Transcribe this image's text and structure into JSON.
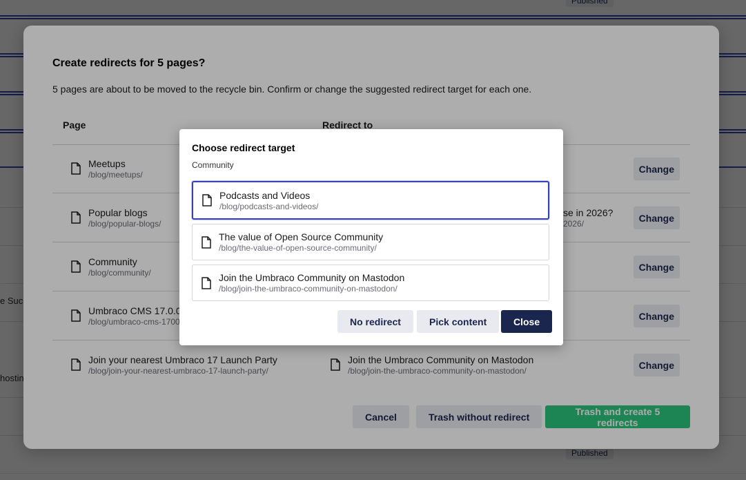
{
  "background": {
    "left_fragments": [
      "e Succ",
      "hostin"
    ],
    "pills": [
      "Published",
      "Published"
    ]
  },
  "dialog": {
    "title": "Create redirects for 5 pages?",
    "description": "5 pages are about to be moved to the recycle bin. Confirm or change the suggested redirect target for each one.",
    "columns": {
      "page": "Page",
      "redirect_to": "Redirect to"
    },
    "rows": [
      {
        "page_name": "Meetups",
        "page_url": "/blog/meetups/",
        "target_name": "",
        "target_url": "",
        "change_label": "Change"
      },
      {
        "page_name": "Popular blogs",
        "page_url": "/blog/popular-blogs/",
        "target_name": "se in 2026?",
        "target_url": "2026/",
        "change_label": "Change"
      },
      {
        "page_name": "Community",
        "page_url": "/blog/community/",
        "target_name": "",
        "target_url": "",
        "change_label": "Change"
      },
      {
        "page_name": "Umbraco CMS 17.0.0",
        "page_url": "/blog/umbraco-cms-1700",
        "target_name": "",
        "target_url": "",
        "change_label": "Change"
      },
      {
        "page_name": "Join your nearest Umbraco 17 Launch Party",
        "page_url": "/blog/join-your-nearest-umbraco-17-launch-party/",
        "target_name": "Join the Umbraco Community on Mastodon",
        "target_url": "/blog/join-the-umbraco-community-on-mastodon/",
        "change_label": "Change"
      }
    ],
    "footer": {
      "cancel": "Cancel",
      "trash_without_redirect": "Trash without redirect",
      "trash_and_create": "Trash and create 5 redirects"
    }
  },
  "picker": {
    "title": "Choose redirect target",
    "breadcrumb": "Community",
    "options": [
      {
        "name": "Podcasts and Videos",
        "url": "/blog/podcasts-and-videos/",
        "selected": true
      },
      {
        "name": "The value of Open Source Community",
        "url": "/blog/the-value-of-open-source-community/",
        "selected": false
      },
      {
        "name": "Join the Umbraco Community on Mastodon",
        "url": "/blog/join-the-umbraco-community-on-mastodon/",
        "selected": false
      }
    ],
    "buttons": {
      "no_redirect": "No redirect",
      "pick_content": "Pick content",
      "close": "Close"
    }
  },
  "colors": {
    "accent": "#1b264f",
    "selected_border": "#3544b1",
    "positive": "#2bc37c"
  },
  "icons": {
    "document": "document-icon"
  }
}
